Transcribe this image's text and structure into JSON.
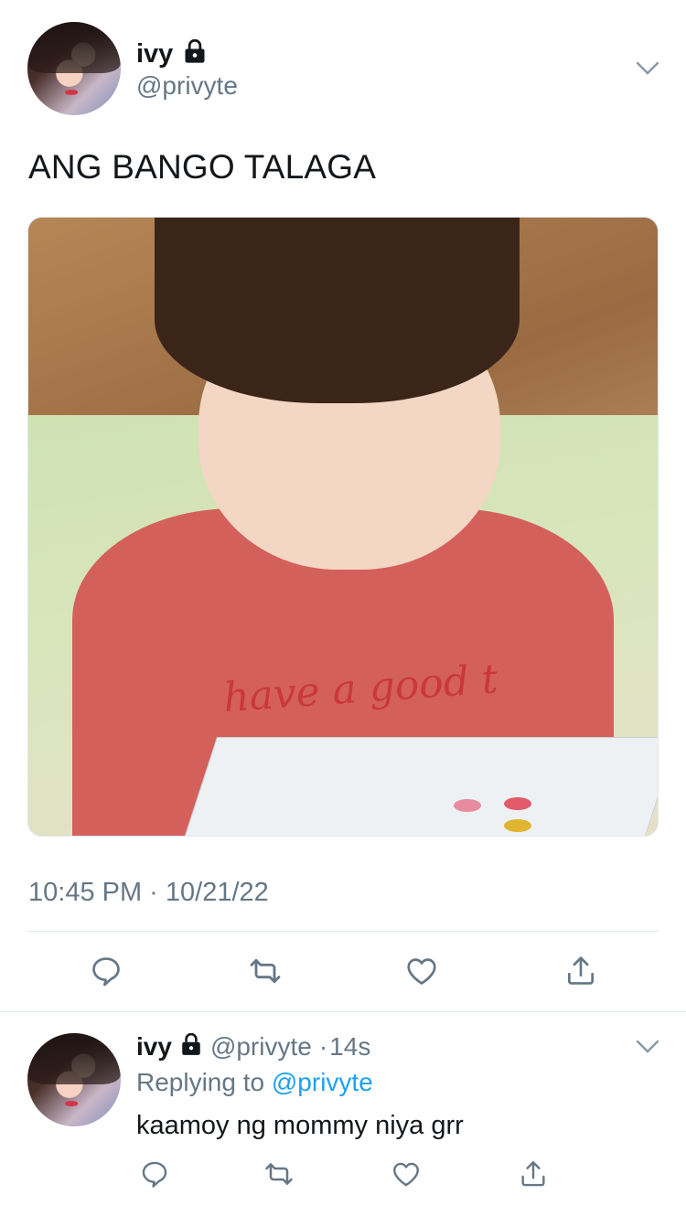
{
  "tweet": {
    "author_name": "ivy",
    "author_handle": "@privyte",
    "text": "ANG BANGO TALAGA",
    "timestamp": "10:45 PM · 10/21/22",
    "photo_caption": "have a good t"
  },
  "reply": {
    "author_name": "ivy",
    "author_handle": "@privyte",
    "separator": "·",
    "age": "14s",
    "replying_prefix": "Replying to",
    "replying_handle": "@privyte",
    "text": "kaamoy ng mommy niya grr"
  },
  "icons": {
    "lock": "lock-icon",
    "menu": "chevron-down-icon",
    "reply": "reply-icon",
    "retweet": "retweet-icon",
    "like": "heart-icon",
    "share": "share-icon"
  },
  "colors": {
    "accent": "#1da1f2",
    "muted": "#657786",
    "border": "#e1e8ed",
    "text": "#14171a"
  }
}
